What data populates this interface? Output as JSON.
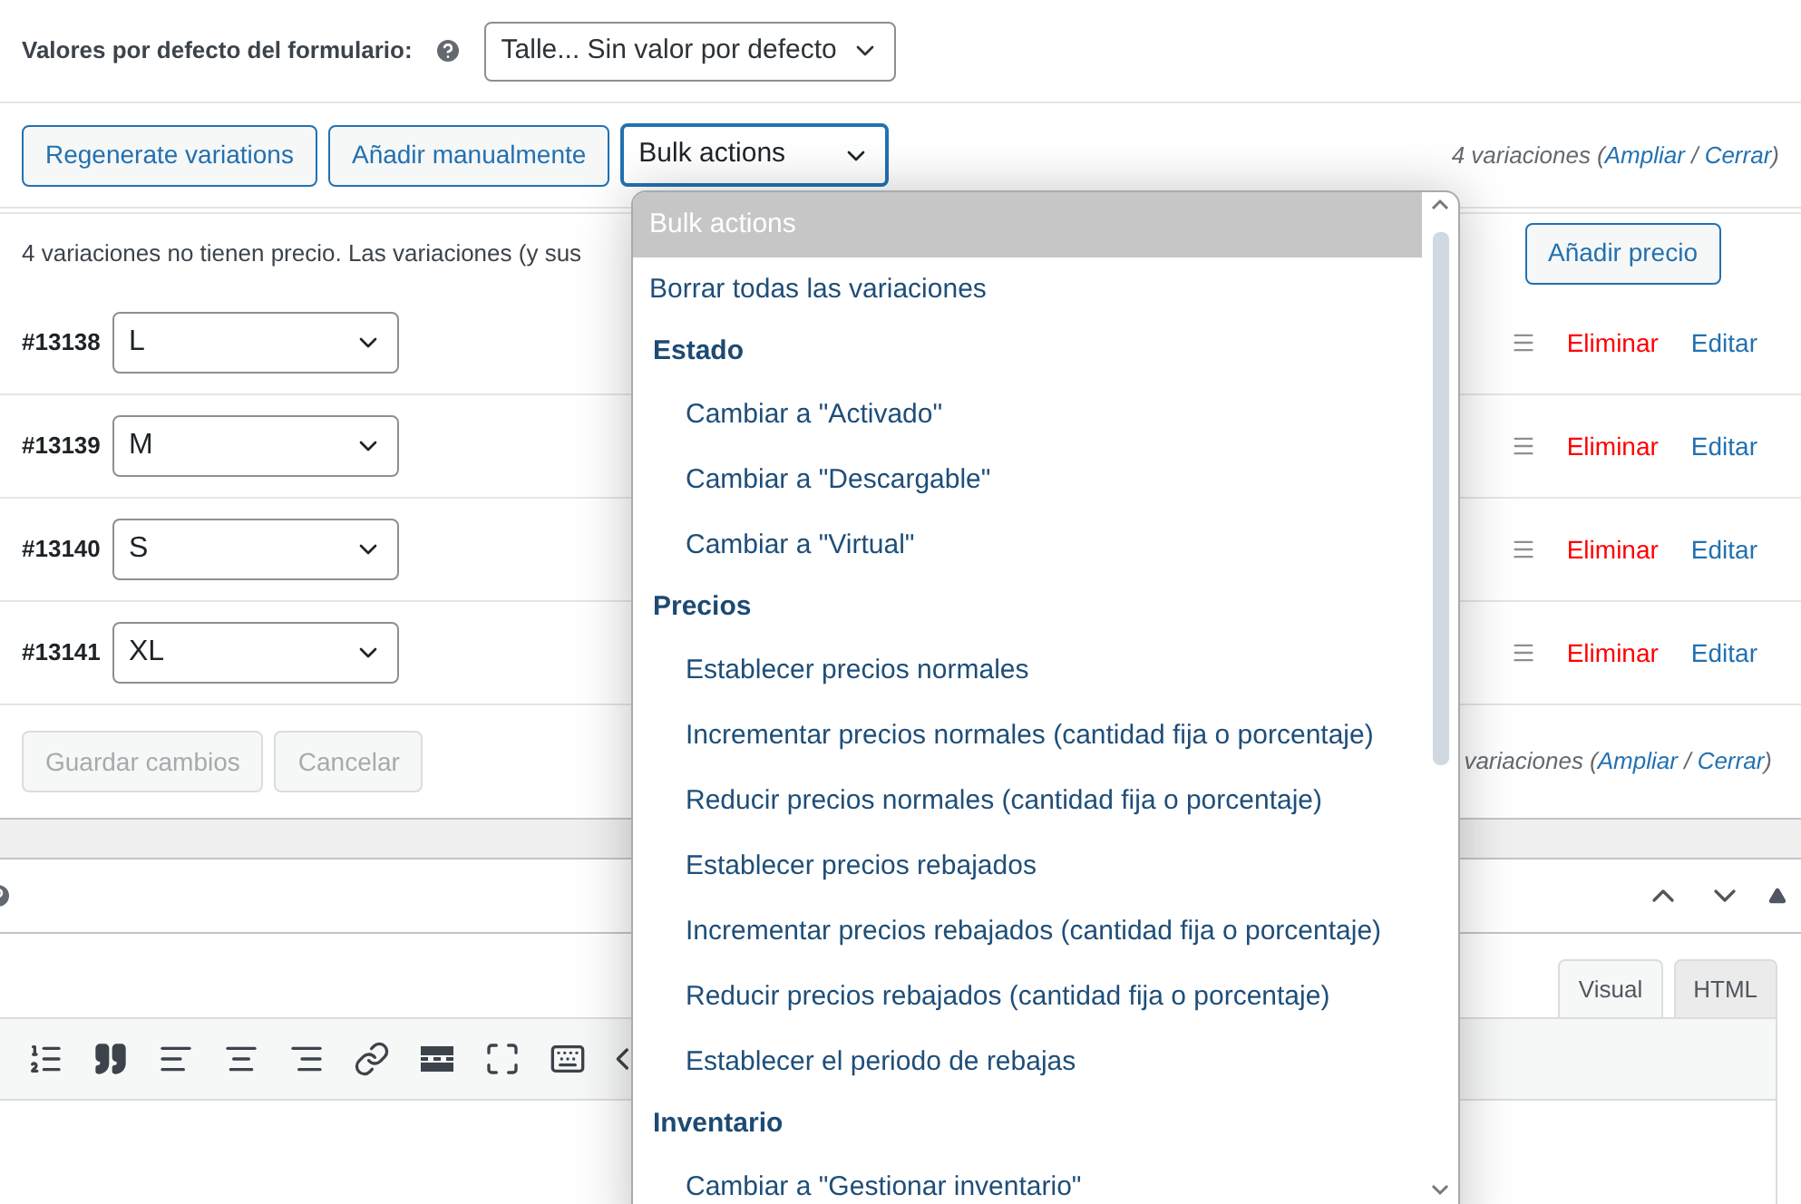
{
  "defaults": {
    "label": "Valores por defecto del formulario:",
    "select": "Talle... Sin valor por defecto"
  },
  "toolbar": {
    "buttons": [
      "Regenerate variations",
      "Añadir manualmente"
    ],
    "bulk_select": "Bulk actions",
    "pagination": [
      {
        "kind": "text",
        "text": "4 variaciones ("
      },
      {
        "kind": "link",
        "text": "Ampliar"
      },
      {
        "kind": "text",
        "text": " / "
      },
      {
        "kind": "link",
        "text": "Cerrar"
      },
      {
        "kind": "text",
        "text": ")"
      }
    ]
  },
  "notice": {
    "text": "4 variaciones no tienen precio. Las variaciones (y sus",
    "button": "Añadir precio"
  },
  "variations": [
    {
      "id": "#13138",
      "value": "L",
      "remove": "Eliminar",
      "edit": "Editar"
    },
    {
      "id": "#13139",
      "value": "M",
      "remove": "Eliminar",
      "edit": "Editar"
    },
    {
      "id": "#13140",
      "value": "S",
      "remove": "Eliminar",
      "edit": "Editar"
    },
    {
      "id": "#13141",
      "value": "XL",
      "remove": "Eliminar",
      "edit": "Editar"
    }
  ],
  "footer": {
    "buttons": [
      {
        "label": "Guardar cambios",
        "disabled": true
      },
      {
        "label": "Cancelar",
        "disabled": true
      }
    ],
    "pagination": [
      {
        "kind": "text",
        "text": "variaciones ("
      },
      {
        "kind": "link",
        "text": "Ampliar"
      },
      {
        "kind": "text",
        "text": " / "
      },
      {
        "kind": "link",
        "text": "Cerrar"
      },
      {
        "kind": "text",
        "text": ")"
      }
    ]
  },
  "editor": {
    "tabs": [
      {
        "label": "Visual",
        "selected": true
      },
      {
        "label": "HTML",
        "selected": false
      }
    ]
  },
  "bulk_menu": {
    "items": [
      {
        "kind": "option",
        "label": "Bulk actions",
        "selected": true
      },
      {
        "kind": "option",
        "label": "Borrar todas las variaciones",
        "selected": false
      },
      {
        "kind": "group",
        "label": "Estado",
        "children": [
          {
            "kind": "option",
            "label": "Cambiar a \"Activado\"",
            "selected": false
          },
          {
            "kind": "option",
            "label": "Cambiar a \"Descargable\"",
            "selected": false
          },
          {
            "kind": "option",
            "label": "Cambiar a \"Virtual\"",
            "selected": false
          }
        ]
      },
      {
        "kind": "group",
        "label": "Precios",
        "children": [
          {
            "kind": "option",
            "label": "Establecer precios normales",
            "selected": false
          },
          {
            "kind": "option",
            "label": "Incrementar precios normales (cantidad fija o porcentaje)",
            "selected": false
          },
          {
            "kind": "option",
            "label": "Reducir precios normales (cantidad fija o porcentaje)",
            "selected": false
          },
          {
            "kind": "option",
            "label": "Establecer precios rebajados",
            "selected": false
          },
          {
            "kind": "option",
            "label": "Incrementar precios rebajados (cantidad fija o porcentaje)",
            "selected": false
          },
          {
            "kind": "option",
            "label": "Reducir precios rebajados (cantidad fija o porcentaje)",
            "selected": false
          },
          {
            "kind": "option",
            "label": "Establecer el periodo de rebajas",
            "selected": false
          }
        ]
      },
      {
        "kind": "group",
        "label": "Inventario",
        "children": [
          {
            "kind": "option",
            "label": "Cambiar a \"Gestionar inventario\"",
            "selected": false
          }
        ]
      }
    ]
  }
}
